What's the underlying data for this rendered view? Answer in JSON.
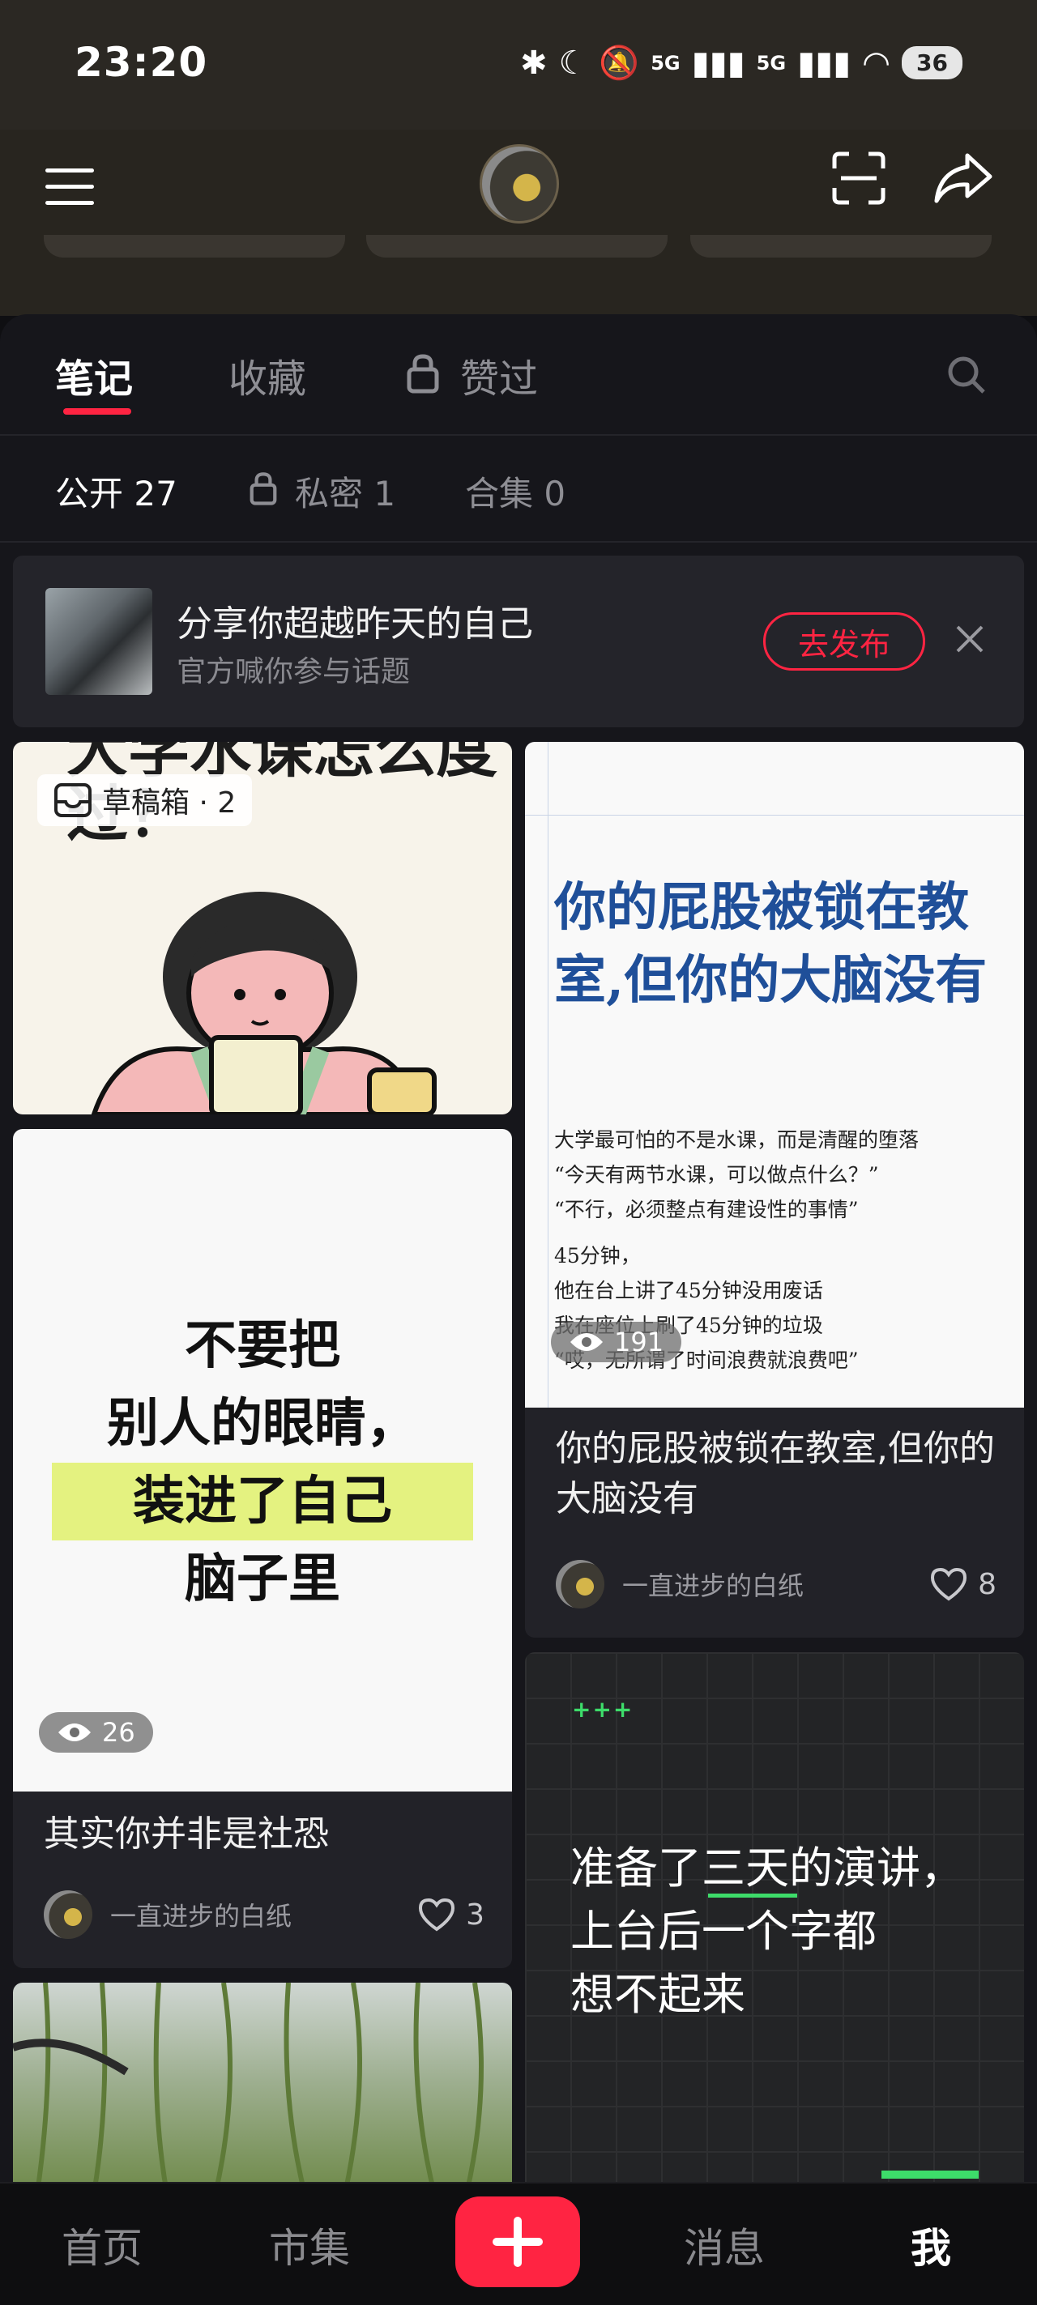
{
  "status_bar": {
    "time": "23:20",
    "signal1": "5G",
    "signal2": "5G",
    "battery": "36"
  },
  "header": {
    "menu_icon": "menu-icon",
    "scan_icon": "scan-icon",
    "share_icon": "share-icon"
  },
  "tabs": [
    {
      "label": "笔记",
      "active": true
    },
    {
      "label": "收藏",
      "active": false
    },
    {
      "label": "赞过",
      "active": false,
      "locked": true
    }
  ],
  "sub_tabs": [
    {
      "label": "公开 27",
      "active": true
    },
    {
      "label": "私密 1",
      "active": false,
      "locked": true
    },
    {
      "label": "合集 0",
      "active": false
    }
  ],
  "promo": {
    "title": "分享你超越昨天的自己",
    "subtitle": "官方喊你参与话题",
    "button": "去发布"
  },
  "draft": {
    "label": "草稿箱 · 2"
  },
  "cards": [
    {
      "cover_top_text": "大学水课怎么度过？",
      "cover_highlight": "水课"
    },
    {
      "cover_lines": [
        "不要把",
        "别人的眼睛，",
        "装进了自己",
        "脑子里"
      ],
      "views": "26",
      "title": "其实你并非是社恐",
      "author": "一直进步的白纸",
      "likes": "3"
    },
    {
      "cover_headline": "你的屁股被锁在教室,但你的大脑没有",
      "cover_body": [
        "大学最可怕的不是水课，而是清醒的堕落",
        "“今天有两节水课，可以做点什么？”",
        "“不行，必须整点有建设性的事情”",
        "45分钟，",
        "他在台上讲了45分钟没用废话",
        "我在座位上刷了45分钟的垃圾",
        "“哎，无所谓了时间浪费就浪费吧”"
      ],
      "views": "191",
      "title": "你的屁股被锁在教室,但你的大脑没有",
      "author": "一直进步的白纸",
      "likes": "8"
    },
    {
      "cover_plus": "+++",
      "cover_lines": [
        "准备了三天的演讲，",
        "上台后一个字都",
        "想不起来"
      ]
    }
  ],
  "bottom_nav": [
    {
      "label": "首页",
      "active": false
    },
    {
      "label": "市集",
      "active": false
    },
    {
      "label": "消息",
      "active": false
    },
    {
      "label": "我",
      "active": true
    }
  ],
  "colors": {
    "accent": "#ff2442",
    "background": "#16161b",
    "card": "#222228"
  }
}
